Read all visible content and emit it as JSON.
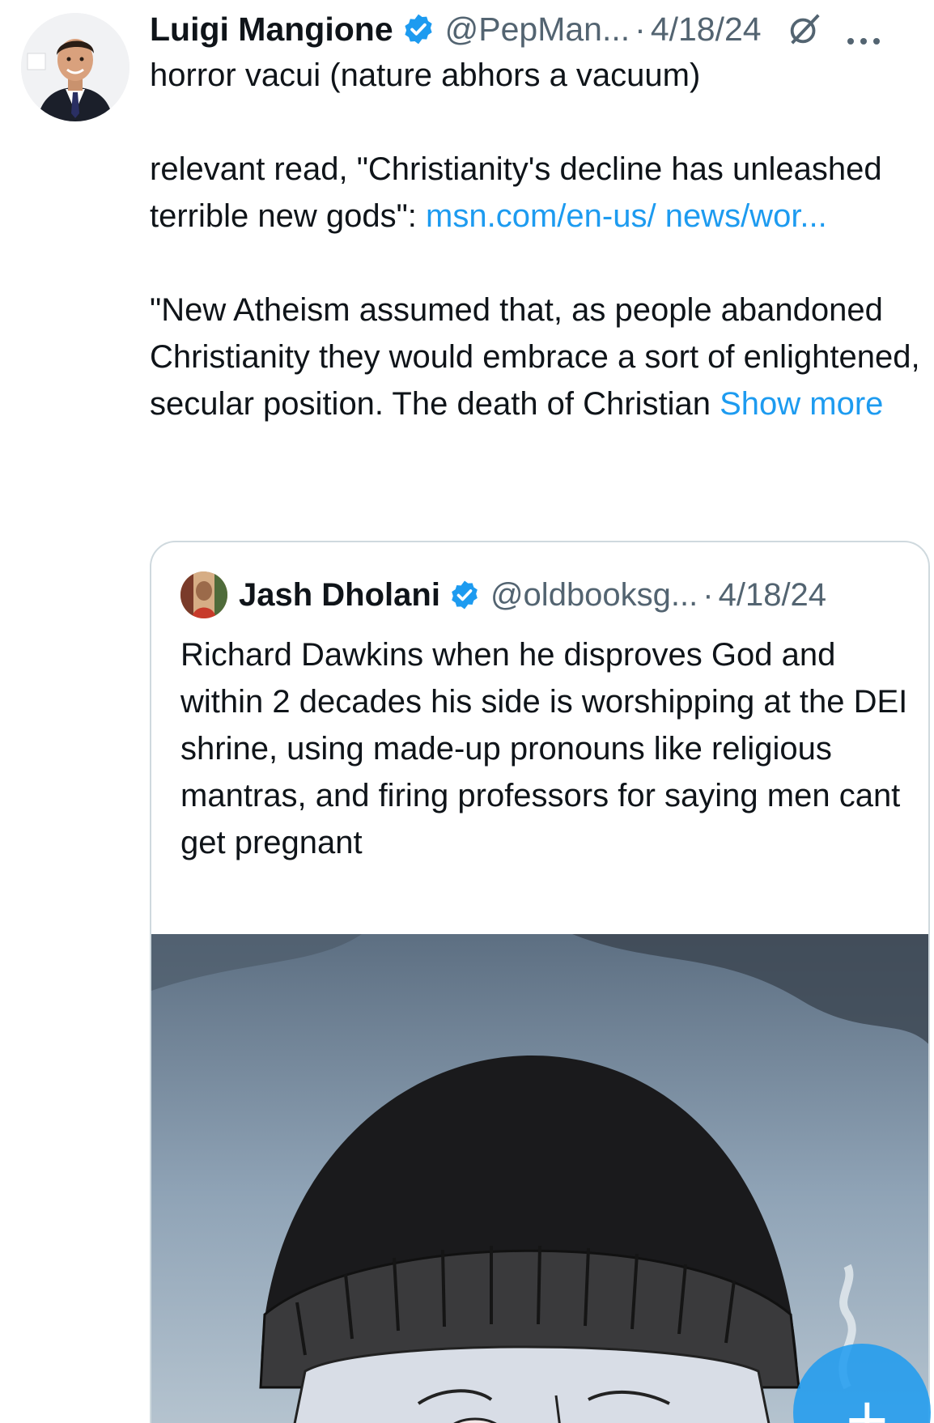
{
  "tweet": {
    "author_name": "Luigi Mangione",
    "handle": "@PepMan...",
    "separator": "·",
    "date": "4/18/24",
    "icons": {
      "verified": "verified-badge-icon",
      "grok": "grok-icon",
      "more": "more-icon"
    },
    "text": {
      "p1": "horror vacui (nature abhors a vacuum)",
      "p2_prefix": "relevant read, \"Christianity's decline has unleashed terrible new gods\": ",
      "p2_link": "msn.com/en-us/ news/wor...",
      "p3": "\"New Atheism assumed that, as people abandoned Christianity they would embrace a sort of enlightened, secular position. The death of Christian ",
      "show_more": "Show more"
    }
  },
  "quote": {
    "author_name": "Jash Dholani",
    "handle": "@oldbooksg...",
    "separator": "·",
    "date": "4/18/24",
    "text": "Richard Dawkins when he disproves God and within 2 decades his side is worshipping at the DEI shrine, using made-up pronouns like religious mantras, and firing professors for saying men cant get pregnant"
  },
  "fab": {
    "label": "+",
    "icon": "compose-plus-icon"
  },
  "colors": {
    "link": "#1d9bf0",
    "secondary": "#536471",
    "border": "#cfd9de",
    "text": "#0f1419"
  }
}
